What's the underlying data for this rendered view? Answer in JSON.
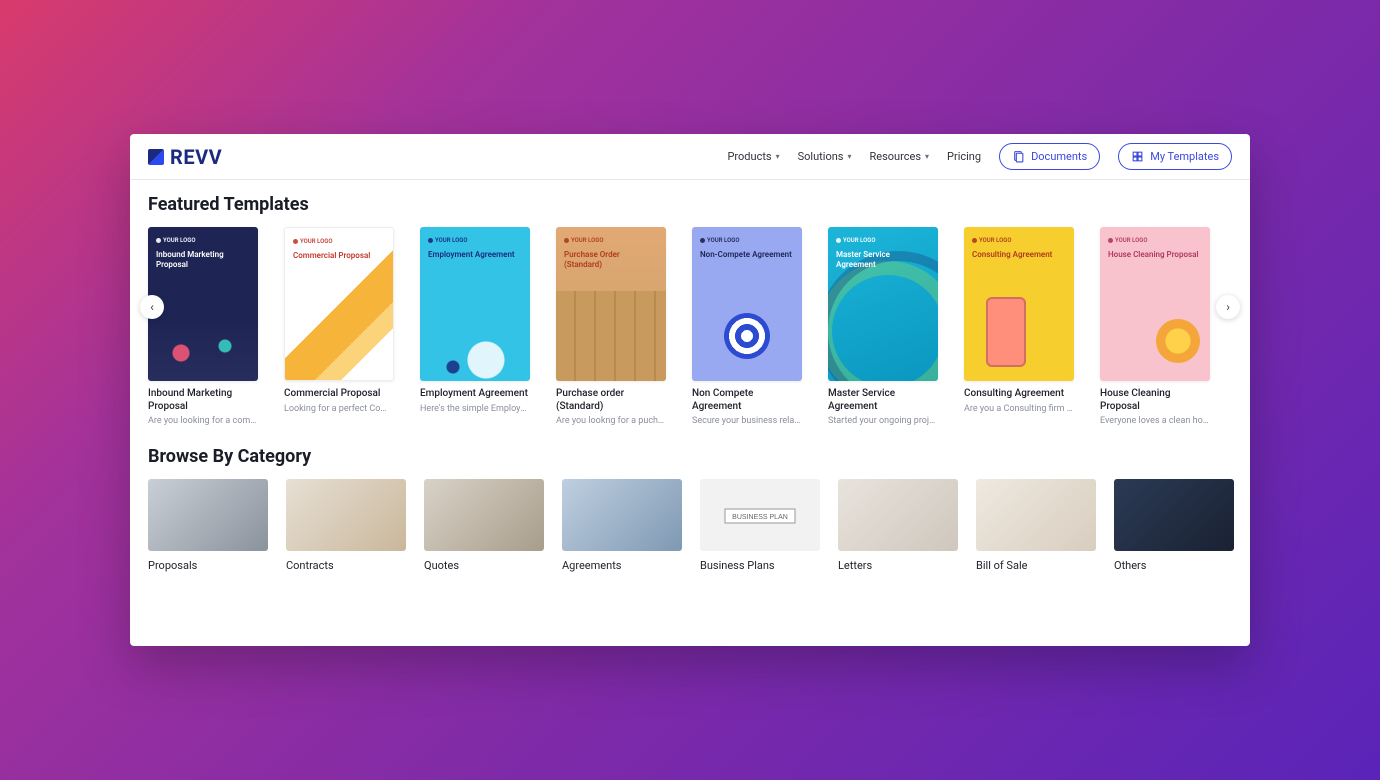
{
  "brand": "REVV",
  "nav": {
    "products": "Products",
    "solutions": "Solutions",
    "resources": "Resources",
    "pricing": "Pricing",
    "documents": "Documents",
    "my_templates": "My Templates"
  },
  "sections": {
    "featured": "Featured Templates",
    "browse": "Browse By Category"
  },
  "your_logo": "YOUR LOGO",
  "templates": [
    {
      "cover_title": "Inbound Marketing Proposal",
      "title": "Inbound Marketing Proposal",
      "desc": "Are you looking for a compr…"
    },
    {
      "cover_title": "Commercial Proposal",
      "title": "Commercial Proposal",
      "desc": "Looking for a perfect Comm…"
    },
    {
      "cover_title": "Employment Agreement",
      "title": "Employment Agreement",
      "desc": "Here's the simple Employe…"
    },
    {
      "cover_title": "Purchase Order (Standard)",
      "title": "Purchase order (Standard)",
      "desc": "Are you lookng for a pucha…"
    },
    {
      "cover_title": "Non-Compete Agreement",
      "title": "Non Compete Agreement",
      "desc": "Secure your business relati…"
    },
    {
      "cover_title": "Master Service Agreement",
      "title": "Master Service Agreement",
      "desc": "Started your ongoing projec…"
    },
    {
      "cover_title": "Consulting Agreement",
      "title": "Consulting Agreement",
      "desc": "Are you a Consulting firm lo…"
    },
    {
      "cover_title": "House Cleaning Proposal",
      "title": "House Cleaning Proposal",
      "desc": "Everyone loves a clean hou…"
    }
  ],
  "categories": [
    {
      "label": "Proposals"
    },
    {
      "label": "Contracts"
    },
    {
      "label": "Quotes"
    },
    {
      "label": "Agreements"
    },
    {
      "label": "Business Plans"
    },
    {
      "label": "Letters"
    },
    {
      "label": "Bill of Sale"
    },
    {
      "label": "Others"
    }
  ]
}
